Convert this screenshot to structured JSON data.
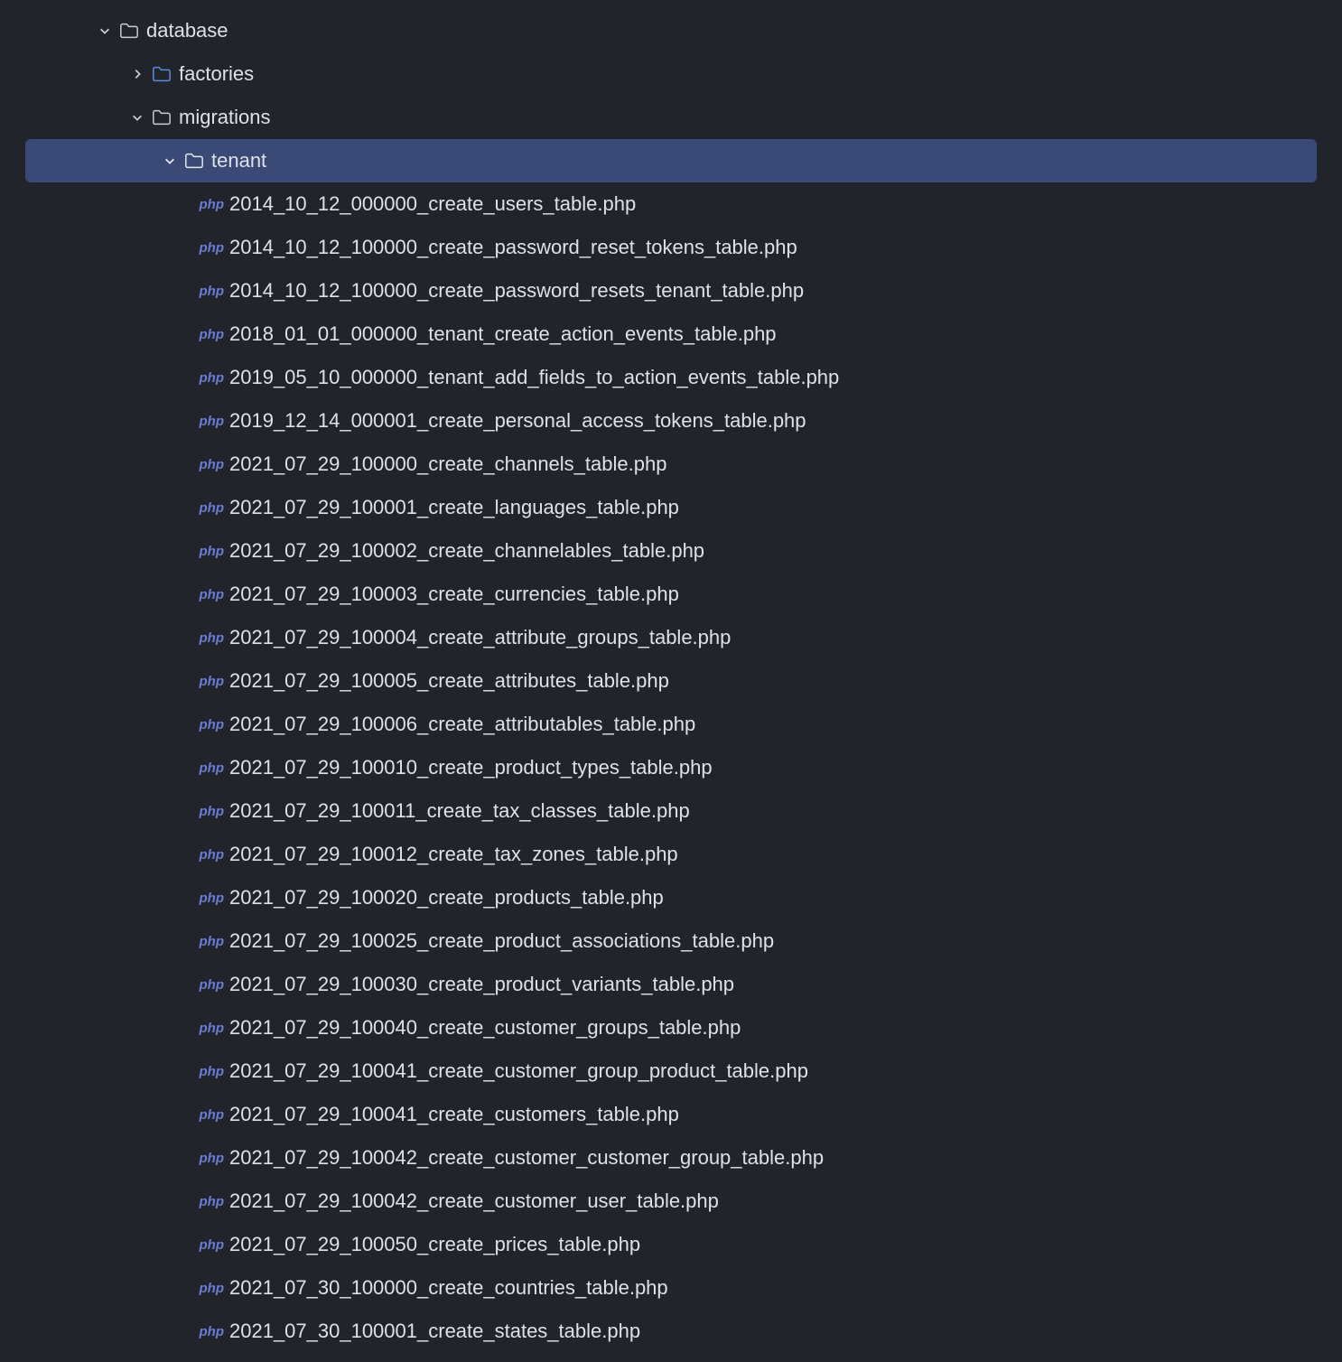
{
  "phpBadge": "php",
  "tree": {
    "database": {
      "label": "database",
      "expanded": true,
      "children": {
        "factories": {
          "label": "factories",
          "expanded": false
        },
        "migrations": {
          "label": "migrations",
          "expanded": true,
          "children": {
            "tenant": {
              "label": "tenant",
              "expanded": true,
              "selected": true,
              "files": [
                "2014_10_12_000000_create_users_table.php",
                "2014_10_12_100000_create_password_reset_tokens_table.php",
                "2014_10_12_100000_create_password_resets_tenant_table.php",
                "2018_01_01_000000_tenant_create_action_events_table.php",
                "2019_05_10_000000_tenant_add_fields_to_action_events_table.php",
                "2019_12_14_000001_create_personal_access_tokens_table.php",
                "2021_07_29_100000_create_channels_table.php",
                "2021_07_29_100001_create_languages_table.php",
                "2021_07_29_100002_create_channelables_table.php",
                "2021_07_29_100003_create_currencies_table.php",
                "2021_07_29_100004_create_attribute_groups_table.php",
                "2021_07_29_100005_create_attributes_table.php",
                "2021_07_29_100006_create_attributables_table.php",
                "2021_07_29_100010_create_product_types_table.php",
                "2021_07_29_100011_create_tax_classes_table.php",
                "2021_07_29_100012_create_tax_zones_table.php",
                "2021_07_29_100020_create_products_table.php",
                "2021_07_29_100025_create_product_associations_table.php",
                "2021_07_29_100030_create_product_variants_table.php",
                "2021_07_29_100040_create_customer_groups_table.php",
                "2021_07_29_100041_create_customer_group_product_table.php",
                "2021_07_29_100041_create_customers_table.php",
                "2021_07_29_100042_create_customer_customer_group_table.php",
                "2021_07_29_100042_create_customer_user_table.php",
                "2021_07_29_100050_create_prices_table.php",
                "2021_07_30_100000_create_countries_table.php",
                "2021_07_30_100001_create_states_table.php"
              ]
            }
          }
        }
      }
    }
  }
}
